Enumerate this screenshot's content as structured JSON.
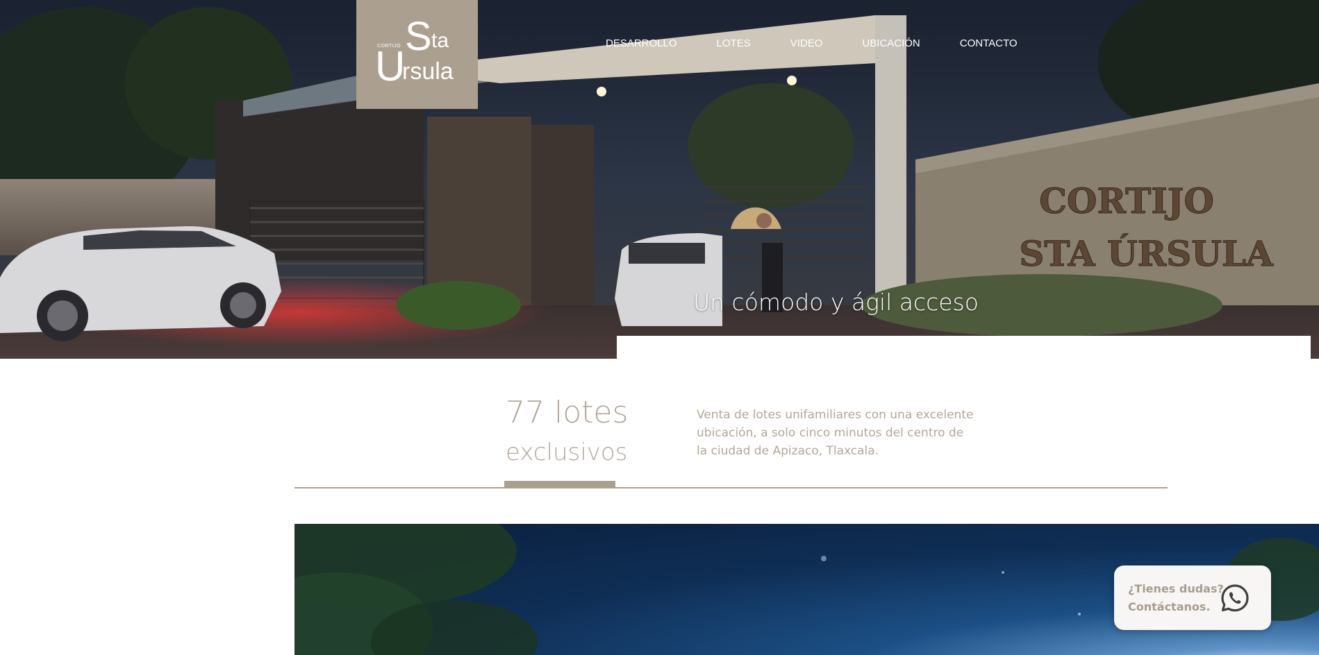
{
  "logo": {
    "small": "CORTIJO",
    "s": "S",
    "ta": "ta",
    "u": "U",
    "rsula": "rsula"
  },
  "nav": {
    "items": [
      "DESARROLLO",
      "LOTES",
      "VIDEO",
      "UBICACIÓN",
      "CONTACTO"
    ]
  },
  "hero": {
    "caption": "Un cómodo y ágil acceso",
    "sign_line1": "CORTIJO",
    "sign_line2": "STA ÚRSULA"
  },
  "intro": {
    "count": "77 lotes",
    "subtitle": "exclusivos",
    "description": "Venta de lotes unifamiliares con una excelente ubicación, a solo cinco minutos del centro de la ciudad de Apizaco, Tlaxcala."
  },
  "whatsapp": {
    "line1": "¿Tienes dudas?",
    "line2": "Contáctanos.",
    "icon": "whatsapp-icon"
  },
  "colors": {
    "brand": "#ab9f8f",
    "text_brand": "#b2a798",
    "white": "#ffffff"
  }
}
